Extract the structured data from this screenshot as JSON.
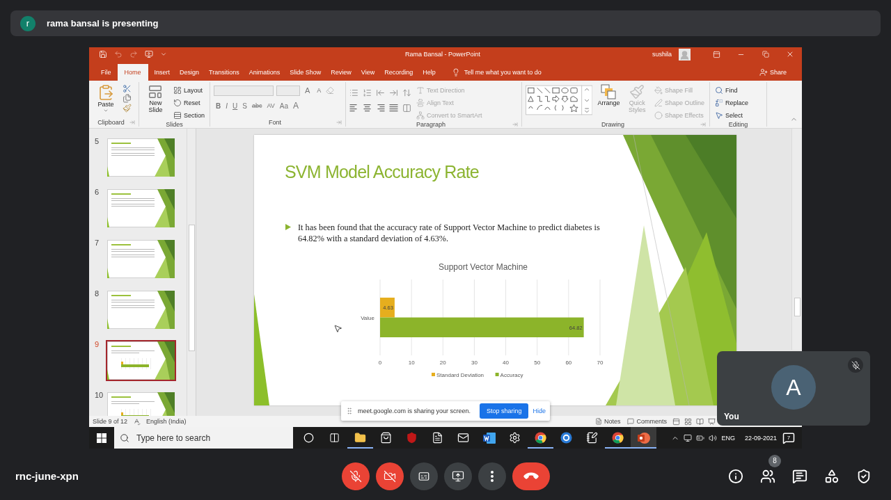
{
  "meet": {
    "presenter": {
      "initial": "r",
      "banner": "rama bansal is presenting"
    },
    "meeting_name": "rnc-june-xpn",
    "controls": [
      {
        "kind": "mic",
        "on": false
      },
      {
        "kind": "camera",
        "on": false
      },
      {
        "kind": "captions",
        "on": false
      },
      {
        "kind": "present",
        "on": false
      },
      {
        "kind": "more"
      },
      {
        "kind": "leave"
      }
    ],
    "side_buttons": [
      {
        "kind": "info"
      },
      {
        "kind": "people",
        "badge": "8"
      },
      {
        "kind": "chat"
      },
      {
        "kind": "activities"
      },
      {
        "kind": "host"
      }
    ],
    "self_tile": {
      "initial": "A",
      "label": "You",
      "muted": true
    }
  },
  "powerpoint": {
    "title": "Rama Bansal - PowerPoint",
    "user": "sushila",
    "tabs": [
      {
        "label": "File",
        "selected": false
      },
      {
        "label": "Home",
        "selected": true
      },
      {
        "label": "Insert",
        "selected": false
      },
      {
        "label": "Design",
        "selected": false
      },
      {
        "label": "Transitions",
        "selected": false
      },
      {
        "label": "Animations",
        "selected": false
      },
      {
        "label": "Slide Show",
        "selected": false
      },
      {
        "label": "Review",
        "selected": false
      },
      {
        "label": "View",
        "selected": false
      },
      {
        "label": "Recording",
        "selected": false
      },
      {
        "label": "Help",
        "selected": false
      }
    ],
    "tell_me": "Tell me what you want to do",
    "share": "Share",
    "ribbon": {
      "clipboard": {
        "label": "Clipboard",
        "paste": "Paste"
      },
      "slides": {
        "label": "Slides",
        "new_slide": "New Slide",
        "layout": "Layout",
        "reset": "Reset",
        "section": "Section"
      },
      "font": {
        "label": "Font",
        "size_buttons": [
          "A",
          "A"
        ],
        "format_buttons": [
          "B",
          "I",
          "U",
          "S",
          "abc",
          "AV",
          "Aa",
          "A"
        ]
      },
      "paragraph": {
        "label": "Paragraph",
        "commands": [
          {
            "label": "Text Direction",
            "disabled": true
          },
          {
            "label": "Align Text",
            "disabled": true
          },
          {
            "label": "Convert to SmartArt",
            "disabled": true
          }
        ]
      },
      "drawing": {
        "label": "Drawing",
        "arrange": "Arrange",
        "quick_styles": {
          "label": "Quick Styles",
          "disabled": true
        },
        "commands": [
          {
            "label": "Shape Fill",
            "disabled": true
          },
          {
            "label": "Shape Outline",
            "disabled": true
          },
          {
            "label": "Shape Effects",
            "disabled": true
          }
        ]
      },
      "editing": {
        "label": "Editing",
        "commands": [
          {
            "label": "Find"
          },
          {
            "label": "Replace"
          },
          {
            "label": "Select"
          }
        ]
      }
    },
    "thumbnails": [
      {
        "number": "5",
        "kind": "text",
        "selected": false
      },
      {
        "number": "6",
        "kind": "text",
        "selected": false
      },
      {
        "number": "7",
        "kind": "text",
        "selected": false
      },
      {
        "number": "8",
        "kind": "text",
        "selected": false
      },
      {
        "number": "9",
        "kind": "chart",
        "selected": true
      },
      {
        "number": "10",
        "kind": "chart",
        "selected": false
      }
    ],
    "slide": {
      "title": "SVM Model Accuracy Rate",
      "bullet": "It has been found that the accuracy rate of Support Vector Machine to predict diabetes is 64.82% with a standard deviation of 4.63%.",
      "chart_data": {
        "type": "bar",
        "orientation": "horizontal",
        "title": "Support Vector Machine",
        "categories": [
          "Value"
        ],
        "series": [
          {
            "name": "Standard Deviation",
            "color": "#e6ae1e",
            "values": [
              4.63
            ]
          },
          {
            "name": "Accuracy",
            "color": "#8cb42a",
            "values": [
              64.82
            ]
          }
        ],
        "xlim": [
          0,
          70
        ],
        "xticks": [
          0,
          10,
          20,
          30,
          40,
          50,
          60,
          70
        ],
        "data_labels": true,
        "grid": true,
        "legend": true
      }
    },
    "status_bar": {
      "slide_position": "Slide 9 of 12",
      "language": "English (India)",
      "notes": "Notes",
      "comments": "Comments"
    }
  },
  "share_notice": {
    "message": "meet.google.com is sharing your screen.",
    "stop": "Stop sharing",
    "hide": "Hide"
  },
  "taskbar": {
    "search_placeholder": "Type here to search",
    "apps": [
      {
        "kind": "cortana",
        "running": false,
        "active": false
      },
      {
        "kind": "taskview",
        "running": false,
        "active": false
      },
      {
        "kind": "explorer",
        "running": true,
        "active": false
      },
      {
        "kind": "store",
        "running": false,
        "active": false
      },
      {
        "kind": "antivirus",
        "running": false,
        "active": false
      },
      {
        "kind": "file",
        "running": false,
        "active": false
      },
      {
        "kind": "mail",
        "running": false,
        "active": false
      },
      {
        "kind": "word",
        "running": false,
        "active": false
      },
      {
        "kind": "settings",
        "running": false,
        "active": false
      },
      {
        "kind": "browser",
        "running": true,
        "active": false
      },
      {
        "kind": "round",
        "running": false,
        "active": false
      },
      {
        "kind": "app",
        "running": false,
        "active": false
      },
      {
        "kind": "browser",
        "running": true,
        "active": false
      },
      {
        "kind": "powerpoint",
        "running": true,
        "active": true
      }
    ],
    "language": "ENG",
    "date": "22-09-2021",
    "notifications": "7"
  }
}
